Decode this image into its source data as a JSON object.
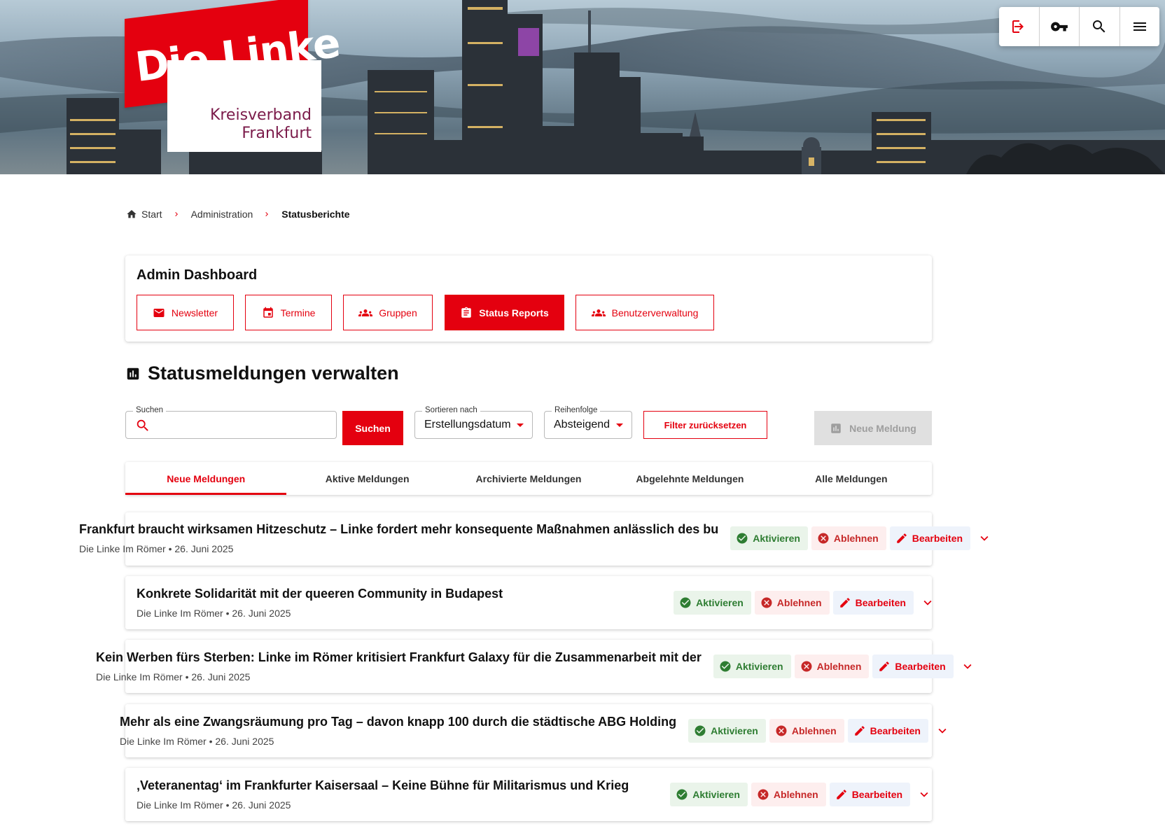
{
  "logo": {
    "wordmark": "Die Linke",
    "sub_line1": "Kreisverband",
    "sub_line2": "Frankfurt"
  },
  "topbar": {
    "icons": [
      "logout-icon",
      "key-icon",
      "search-icon",
      "menu-icon"
    ]
  },
  "breadcrumb": {
    "home": "Start",
    "level1": "Administration",
    "current": "Statusberichte"
  },
  "admin": {
    "title": "Admin Dashboard",
    "buttons": [
      {
        "label": "Newsletter",
        "icon": "mail-icon"
      },
      {
        "label": "Termine",
        "icon": "calendar-icon"
      },
      {
        "label": "Gruppen",
        "icon": "groups-icon"
      },
      {
        "label": "Status Reports",
        "icon": "clipboard-icon"
      },
      {
        "label": "Benutzerverwaltung",
        "icon": "groups-icon"
      }
    ],
    "active_button": "Status Reports"
  },
  "section": {
    "title": "Statusmeldungen verwalten"
  },
  "filters": {
    "search_label": "Suchen",
    "search_value": "",
    "search_button": "Suchen",
    "sort_label": "Sortieren nach",
    "sort_value": "Erstellungsdatum",
    "order_label": "Reihenfolge",
    "order_value": "Absteigend",
    "reset_button": "Filter zurücksetzen",
    "new_button": "Neue Meldung"
  },
  "tabs": [
    {
      "label": "Neue Meldungen",
      "active": true
    },
    {
      "label": "Aktive Meldungen",
      "active": false
    },
    {
      "label": "Archivierte Meldungen",
      "active": false
    },
    {
      "label": "Abgelehnte Meldungen",
      "active": false
    },
    {
      "label": "Alle Meldungen",
      "active": false
    }
  ],
  "actions": {
    "activate": "Aktivieren",
    "reject": "Ablehnen",
    "edit": "Bearbeiten"
  },
  "reports": [
    {
      "title": "Frankfurt braucht wirksamen Hitzeschutz – Linke fordert mehr konsequente Maßnahmen anlässlich des bu",
      "meta": "Die Linke Im Römer • 26. Juni 2025"
    },
    {
      "title": "Konkrete Solidarität mit der queeren Community in Budapest",
      "meta": "Die Linke Im Römer • 26. Juni 2025"
    },
    {
      "title": "Kein Werben fürs Sterben: Linke im Römer kritisiert Frankfurt Galaxy für die Zusammenarbeit mit der",
      "meta": "Die Linke Im Römer • 26. Juni 2025"
    },
    {
      "title": "Mehr als eine Zwangsräumung pro Tag – davon knapp 100 durch die städtische ABG Holding",
      "meta": "Die Linke Im Römer • 26. Juni 2025"
    },
    {
      "title": "‚Veteranentag‘ im Frankfurter Kaisersaal – Keine Bühne für Militarismus und Krieg",
      "meta": "Die Linke Im Römer • 26. Juni 2025"
    }
  ],
  "colors": {
    "brand_red": "#e4000f",
    "logo_sub_text": "#7b1b4a",
    "activate_green": "#2e7d32",
    "reject_red": "#c62828"
  }
}
